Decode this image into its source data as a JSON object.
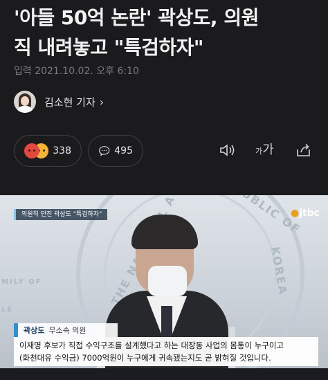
{
  "article": {
    "headline_line1": "'아들 50억 논란' 곽상도, 의원",
    "headline_line2": "직 내려놓고 \"특검하자\"",
    "date": "입력 2021.10.02. 오후 6:10",
    "reporter": "김소현 기자",
    "reporter_chevron": "›"
  },
  "actions": {
    "reaction_count": "338",
    "comment_count": "495",
    "font_size_small": "가",
    "font_size_big": "가"
  },
  "video": {
    "tag": "의원직 던진 곽상도 \"특검하자\"",
    "broadcaster": "jtbc",
    "seal_text_1": "THE NATIONAL A",
    "seal_text_2": "PUBLIC OF",
    "seal_text_3": "KOREA",
    "seal_text_4": "MILY OF",
    "seal_text_5": "LE",
    "speaker_name": "곽상도",
    "speaker_role": "무소속 의원",
    "quote_line1": "이재명 후보가 직접 수익구조를 설계했다고 하는 대장동 사업의 몸통이 누구이고",
    "quote_line2": "(화천대유 수익금) 7000억원이 누구에게 귀속됐는지도 곧 밝혀질 것입니다."
  },
  "colors": {
    "background": "#1b1b1d",
    "accent_blue": "#2f8fcf",
    "reaction_angry": "#e2483d",
    "reaction_sad": "#f3b43a"
  },
  "icons": [
    "reaction-angry-icon",
    "reaction-sad-icon",
    "comment-icon",
    "speaker-icon",
    "font-size-icon",
    "share-icon"
  ]
}
